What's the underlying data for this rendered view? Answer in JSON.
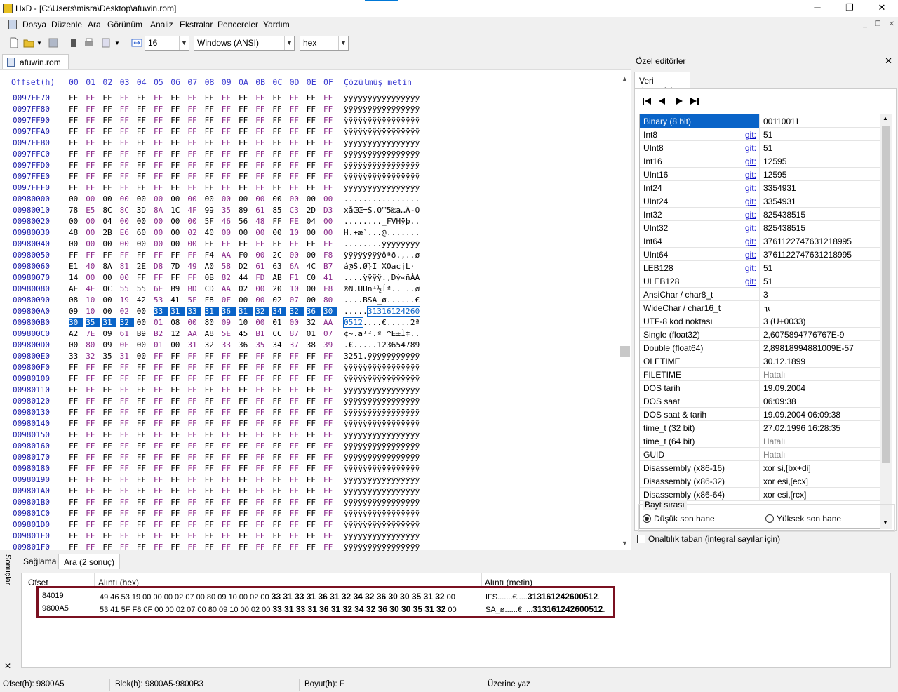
{
  "window": {
    "title": "HxD - [C:\\Users\\misra\\Desktop\\afuwin.rom]",
    "minimize": "─",
    "maximize": "❐",
    "close": "✕"
  },
  "menu": [
    "Dosya",
    "Düzenle",
    "Ara",
    "Görünüm",
    "Analiz",
    "Ekstralar",
    "Pencereler",
    "Yardım"
  ],
  "mdi": {
    "minimize": "_",
    "restore": "❐",
    "close": "✕"
  },
  "toolbar": {
    "bytes_per_row": "16",
    "charset": "Windows (ANSI)",
    "view": "hex"
  },
  "document_tab": "afuwin.rom",
  "hex": {
    "offset_header": "Offset(h)",
    "col_headers": [
      "00",
      "01",
      "02",
      "03",
      "04",
      "05",
      "06",
      "07",
      "08",
      "09",
      "0A",
      "0B",
      "0C",
      "0D",
      "0E",
      "0F"
    ],
    "text_header": "Çözülmüş metin",
    "rows": [
      {
        "off": "0097FF70",
        "b": "FF FF FF FF FF FF FF FF FF FF FF FF FF FF FF FF",
        "t": "ÿÿÿÿÿÿÿÿÿÿÿÿÿÿÿÿ"
      },
      {
        "off": "0097FF80",
        "b": "FF FF FF FF FF FF FF FF FF FF FF FF FF FF FF FF",
        "t": "ÿÿÿÿÿÿÿÿÿÿÿÿÿÿÿÿ"
      },
      {
        "off": "0097FF90",
        "b": "FF FF FF FF FF FF FF FF FF FF FF FF FF FF FF FF",
        "t": "ÿÿÿÿÿÿÿÿÿÿÿÿÿÿÿÿ"
      },
      {
        "off": "0097FFA0",
        "b": "FF FF FF FF FF FF FF FF FF FF FF FF FF FF FF FF",
        "t": "ÿÿÿÿÿÿÿÿÿÿÿÿÿÿÿÿ"
      },
      {
        "off": "0097FFB0",
        "b": "FF FF FF FF FF FF FF FF FF FF FF FF FF FF FF FF",
        "t": "ÿÿÿÿÿÿÿÿÿÿÿÿÿÿÿÿ"
      },
      {
        "off": "0097FFC0",
        "b": "FF FF FF FF FF FF FF FF FF FF FF FF FF FF FF FF",
        "t": "ÿÿÿÿÿÿÿÿÿÿÿÿÿÿÿÿ"
      },
      {
        "off": "0097FFD0",
        "b": "FF FF FF FF FF FF FF FF FF FF FF FF FF FF FF FF",
        "t": "ÿÿÿÿÿÿÿÿÿÿÿÿÿÿÿÿ"
      },
      {
        "off": "0097FFE0",
        "b": "FF FF FF FF FF FF FF FF FF FF FF FF FF FF FF FF",
        "t": "ÿÿÿÿÿÿÿÿÿÿÿÿÿÿÿÿ"
      },
      {
        "off": "0097FFF0",
        "b": "FF FF FF FF FF FF FF FF FF FF FF FF FF FF FF FF",
        "t": "ÿÿÿÿÿÿÿÿÿÿÿÿÿÿÿÿ"
      },
      {
        "off": "00980000",
        "b": "00 00 00 00 00 00 00 00 00 00 00 00 00 00 00 00",
        "t": "................"
      },
      {
        "off": "00980010",
        "b": "78 E5 8C 8C 3D 8A 1C 4F 99 35 89 61 85 C3 2D D3",
        "t": "xåŒŒ=Š.O™5‰a…Ã-Ó"
      },
      {
        "off": "00980020",
        "b": "00 00 04 00 00 00 00 00 5F 46 56 48 FF FE 04 00",
        "t": "........_FVHÿþ.."
      },
      {
        "off": "00980030",
        "b": "48 00 2B E6 60 00 00 02 40 00 00 00 00 10 00 00",
        "t": "H.+æ`...@......."
      },
      {
        "off": "00980040",
        "b": "00 00 00 00 00 00 00 00 FF FF FF FF FF FF FF FF",
        "t": "........ÿÿÿÿÿÿÿÿ"
      },
      {
        "off": "00980050",
        "b": "FF FF FF FF FF FF FF FF F4 AA F0 00 2C 00 00 F8",
        "t": "ÿÿÿÿÿÿÿÿôªð.,..ø"
      },
      {
        "off": "00980060",
        "b": "E1 40 8A 81 2E D8 7D 49 A0 58 D2 61 63 6A 4C B7",
        "t": "á@Š.Ø}I XÒacjL·"
      },
      {
        "off": "00980070",
        "b": "14 00 00 00 FF FF FF FF 0B 82 44 FD AB F1 C0 41",
        "t": "....ÿÿÿÿ.‚Dý«ñÀA"
      },
      {
        "off": "00980080",
        "b": "AE 4E 0C 55 55 6E B9 BD CD AA 02 00 20 10 00 F8",
        "t": "®N.UUn¹½Íª.. ..ø"
      },
      {
        "off": "00980090",
        "b": "08 10 00 19 42 53 41 5F F8 0F 00 00 02 07 00 80",
        "t": "....BSA_ø......€"
      },
      {
        "off": "009800A0",
        "b": "09 10 00 02 00 33 31 33 31 36 31 32 34 32 36 30",
        "t": ".....3131612426 0"
      },
      {
        "off": "009800B0",
        "b": "30 35 31 32 00 01 08 00 80 09 10 00 01 00 32 AA",
        "t": "0512....€.....2ª"
      },
      {
        "off": "009800C0",
        "b": "A2 7E 09 61 B9 B2 12 AA A8 5E 45 B1 CC 87 01 07",
        "t": "¢~.a¹².ª¨^E±Ì‡.."
      },
      {
        "off": "009800D0",
        "b": "00 80 09 0E 00 01 00 31 32 33 36 35 34 37 38 39",
        "t": ".€.....123654789"
      },
      {
        "off": "009800E0",
        "b": "33 32 35 31 00 FF FF FF FF FF FF FF FF FF FF FF",
        "t": "3251.ÿÿÿÿÿÿÿÿÿÿÿ"
      },
      {
        "off": "009800F0",
        "b": "FF FF FF FF FF FF FF FF FF FF FF FF FF FF FF FF",
        "t": "ÿÿÿÿÿÿÿÿÿÿÿÿÿÿÿÿ"
      },
      {
        "off": "00980100",
        "b": "FF FF FF FF FF FF FF FF FF FF FF FF FF FF FF FF",
        "t": "ÿÿÿÿÿÿÿÿÿÿÿÿÿÿÿÿ"
      },
      {
        "off": "00980110",
        "b": "FF FF FF FF FF FF FF FF FF FF FF FF FF FF FF FF",
        "t": "ÿÿÿÿÿÿÿÿÿÿÿÿÿÿÿÿ"
      },
      {
        "off": "00980120",
        "b": "FF FF FF FF FF FF FF FF FF FF FF FF FF FF FF FF",
        "t": "ÿÿÿÿÿÿÿÿÿÿÿÿÿÿÿÿ"
      },
      {
        "off": "00980130",
        "b": "FF FF FF FF FF FF FF FF FF FF FF FF FF FF FF FF",
        "t": "ÿÿÿÿÿÿÿÿÿÿÿÿÿÿÿÿ"
      },
      {
        "off": "00980140",
        "b": "FF FF FF FF FF FF FF FF FF FF FF FF FF FF FF FF",
        "t": "ÿÿÿÿÿÿÿÿÿÿÿÿÿÿÿÿ"
      },
      {
        "off": "00980150",
        "b": "FF FF FF FF FF FF FF FF FF FF FF FF FF FF FF FF",
        "t": "ÿÿÿÿÿÿÿÿÿÿÿÿÿÿÿÿ"
      },
      {
        "off": "00980160",
        "b": "FF FF FF FF FF FF FF FF FF FF FF FF FF FF FF FF",
        "t": "ÿÿÿÿÿÿÿÿÿÿÿÿÿÿÿÿ"
      },
      {
        "off": "00980170",
        "b": "FF FF FF FF FF FF FF FF FF FF FF FF FF FF FF FF",
        "t": "ÿÿÿÿÿÿÿÿÿÿÿÿÿÿÿÿ"
      },
      {
        "off": "00980180",
        "b": "FF FF FF FF FF FF FF FF FF FF FF FF FF FF FF FF",
        "t": "ÿÿÿÿÿÿÿÿÿÿÿÿÿÿÿÿ"
      },
      {
        "off": "00980190",
        "b": "FF FF FF FF FF FF FF FF FF FF FF FF FF FF FF FF",
        "t": "ÿÿÿÿÿÿÿÿÿÿÿÿÿÿÿÿ"
      },
      {
        "off": "009801A0",
        "b": "FF FF FF FF FF FF FF FF FF FF FF FF FF FF FF FF",
        "t": "ÿÿÿÿÿÿÿÿÿÿÿÿÿÿÿÿ"
      },
      {
        "off": "009801B0",
        "b": "FF FF FF FF FF FF FF FF FF FF FF FF FF FF FF FF",
        "t": "ÿÿÿÿÿÿÿÿÿÿÿÿÿÿÿÿ"
      },
      {
        "off": "009801C0",
        "b": "FF FF FF FF FF FF FF FF FF FF FF FF FF FF FF FF",
        "t": "ÿÿÿÿÿÿÿÿÿÿÿÿÿÿÿÿ"
      },
      {
        "off": "009801D0",
        "b": "FF FF FF FF FF FF FF FF FF FF FF FF FF FF FF FF",
        "t": "ÿÿÿÿÿÿÿÿÿÿÿÿÿÿÿÿ"
      },
      {
        "off": "009801E0",
        "b": "FF FF FF FF FF FF FF FF FF FF FF FF FF FF FF FF",
        "t": "ÿÿÿÿÿÿÿÿÿÿÿÿÿÿÿÿ"
      },
      {
        "off": "009801F0",
        "b": "FF FF FF FF FF FF FF FF FF FF FF FF FF FF FF FF",
        "t": "ÿÿÿÿÿÿÿÿÿÿÿÿÿÿÿÿ"
      }
    ]
  },
  "right_panel": {
    "title": "Özel editörler",
    "close": "✕",
    "tab": "Veri denetçisi",
    "goto_label": "git:",
    "rows": [
      {
        "name": "Binary (8 bit)",
        "link": false,
        "value": "00110011",
        "selected": true
      },
      {
        "name": "Int8",
        "link": true,
        "value": "51"
      },
      {
        "name": "UInt8",
        "link": true,
        "value": "51"
      },
      {
        "name": "Int16",
        "link": true,
        "value": "12595"
      },
      {
        "name": "UInt16",
        "link": true,
        "value": "12595"
      },
      {
        "name": "Int24",
        "link": true,
        "value": "3354931"
      },
      {
        "name": "UInt24",
        "link": true,
        "value": "3354931"
      },
      {
        "name": "Int32",
        "link": true,
        "value": "825438515"
      },
      {
        "name": "UInt32",
        "link": true,
        "value": "825438515"
      },
      {
        "name": "Int64",
        "link": true,
        "value": "3761122747631218995"
      },
      {
        "name": "UInt64",
        "link": true,
        "value": "3761122747631218995"
      },
      {
        "name": "LEB128",
        "link": true,
        "value": "51"
      },
      {
        "name": "ULEB128",
        "link": true,
        "value": "51"
      },
      {
        "name": "AnsiChar / char8_t",
        "link": false,
        "value": "3"
      },
      {
        "name": "WideChar / char16_t",
        "link": false,
        "value": "ㄳ"
      },
      {
        "name": "UTF-8 kod noktası",
        "link": false,
        "value": "3 (U+0033)"
      },
      {
        "name": "Single (float32)",
        "link": false,
        "value": "2,6075894776767E-9"
      },
      {
        "name": "Double (float64)",
        "link": false,
        "value": "2,89818994881009E-57"
      },
      {
        "name": "OLETIME",
        "link": false,
        "value": "30.12.1899"
      },
      {
        "name": "FILETIME",
        "link": false,
        "value": "Hatalı",
        "dim": true
      },
      {
        "name": "DOS tarih",
        "link": false,
        "value": "19.09.2004"
      },
      {
        "name": "DOS saat",
        "link": false,
        "value": "06:09:38"
      },
      {
        "name": "DOS saat & tarih",
        "link": false,
        "value": "19.09.2004 06:09:38"
      },
      {
        "name": "time_t (32 bit)",
        "link": false,
        "value": "27.02.1996 16:28:35"
      },
      {
        "name": "time_t (64 bit)",
        "link": false,
        "value": "Hatalı",
        "dim": true
      },
      {
        "name": "GUID",
        "link": false,
        "value": "Hatalı",
        "dim": true
      },
      {
        "name": "Disassembly (x86-16)",
        "link": false,
        "value": "xor si,[bx+di]"
      },
      {
        "name": "Disassembly (x86-32)",
        "link": false,
        "value": "xor esi,[ecx]"
      },
      {
        "name": "Disassembly (x86-64)",
        "link": false,
        "value": "xor esi,[rcx]"
      }
    ],
    "byte_order_title": "Bayt sırası",
    "little_endian": "Düşük son hane",
    "big_endian": "Yüksek son hane",
    "hex_base": "Onaltılık taban (integral sayılar için)"
  },
  "results": {
    "side_label": "Sonuçlar",
    "side_close": "✕",
    "tabs": [
      "Sağlama",
      "Ara (2 sonuç)"
    ],
    "columns": [
      "Ofset",
      "Alıntı (hex)",
      "Alıntı (metin)"
    ],
    "rows": [
      {
        "offset": "84019",
        "hex_pre": "49 46 53 19 00 00 00 02 07 00 80 09 10 00 02 00 ",
        "hex_match": "33 31 33 31 36 31 32 34 32 36 30 30 35 31 32",
        "hex_post": " 00",
        "text_pre": "IFS.......€.....",
        "text_match": "313161242600512",
        "text_post": "."
      },
      {
        "offset": "9800A5",
        "hex_pre": "53 41 5F F8 0F 00 00 02 07 00 80 09 10 00 02 00 ",
        "hex_match": "33 31 33 31 36 31 32 34 32 36 30 30 35 31 32",
        "hex_post": " 00",
        "text_pre": "SA_ø......€.....",
        "text_match": "313161242600512",
        "text_post": "."
      }
    ]
  },
  "status": {
    "offset": "Ofset(h): 9800A5",
    "block": "Blok(h): 9800A5-9800B3",
    "size": "Boyut(h): F",
    "mode": "Üzerine yaz"
  },
  "colors": {
    "selection": "#0a64c8",
    "offset": "#1a1aa8",
    "odd_column": "#8a2a8a",
    "header": "#3a3ad0",
    "highlight_box": "#7a1020"
  }
}
